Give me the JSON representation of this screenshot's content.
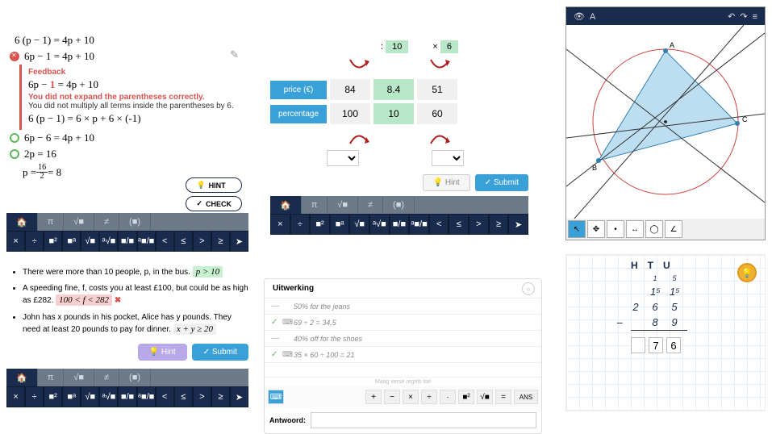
{
  "panel1": {
    "step1": "6 (p − 1) = 4p + 10",
    "step2": "6p − 1 = 4p + 10",
    "feedback": {
      "title": "Feedback",
      "eq_pre": "6p − ",
      "eq_red": "1",
      "eq_post": " = 4p + 10",
      "msg": "You did not expand the parentheses correctly.",
      "note": "You did not multiply all terms inside the parentheses by 6.",
      "expand": "6 (p − 1) = 6 × p + 6 × (-1)"
    },
    "step3": "6p − 6 = 4p + 10",
    "step4": "2p = 16",
    "step5_pre": "p = ",
    "step5_num": "16",
    "step5_den": "2",
    "step5_post": " = 8",
    "hint": "HINT",
    "check": "CHECK"
  },
  "panel2": {
    "op1_sym": ":",
    "op1_val": "10",
    "op2_sym": "×",
    "op2_val": "6",
    "row1_label": "price (€)",
    "row1": [
      "84",
      "8.4",
      "51"
    ],
    "row2_label": "percentage",
    "row2": [
      "100",
      "10",
      "60"
    ],
    "hint": "Hint",
    "submit": "Submit"
  },
  "panel3": {
    "labels": [
      "A",
      "B",
      "C"
    ]
  },
  "panel4": {
    "li1_text": "There were more than 10 people, p, in the bus.  ",
    "li1_chip": "p > 10",
    "li2_text": "A speeding fine, f, costs you at least £100, but could be as high as £282.  ",
    "li2_chip": "100 < f < 282",
    "li3_text": "John has x pounds in his pocket, Alice has y pounds. They need at least 20 pounds to pay for dinner.  ",
    "li3_chip": "x + y ≥ 20",
    "hint": "Hint",
    "submit": "Submit"
  },
  "panel5": {
    "title": "Uitwerking",
    "rows": [
      {
        "mark": "—",
        "kb": "",
        "txt": "50% for the jeans"
      },
      {
        "mark": "✓",
        "kb": "⌨",
        "txt": "69 ÷ 2 = 34,5"
      },
      {
        "mark": "—",
        "kb": "",
        "txt": "40% off for the shoes"
      },
      {
        "mark": "✓",
        "kb": "⌨",
        "txt": "35 × 60 ÷ 100 = 21"
      }
    ],
    "note": "Maag verse regels toe",
    "keys": [
      "+",
      "−",
      "×",
      "÷",
      "·",
      "■²",
      "√■",
      "=",
      "ANS"
    ],
    "answer_label": "Antwoord:"
  },
  "panel6": {
    "headers": [
      "H",
      "T",
      "U"
    ],
    "carry_row": [
      "",
      "1",
      "5"
    ],
    "row1": [
      "",
      "1⁵",
      "1⁵"
    ],
    "row2": [
      "2",
      "6",
      "5"
    ],
    "row3": [
      "",
      "8",
      "9"
    ],
    "ans": [
      "",
      "7",
      "6"
    ]
  },
  "toolbar": {
    "tabs": [
      "π",
      "√■",
      "≠",
      "(■)"
    ],
    "keys": [
      "×",
      "÷",
      "■²",
      "■ᵃ",
      "√■",
      "ᵃ√■",
      "■/■",
      "ᵃ■/■",
      "<",
      "≤",
      ">",
      "≥",
      "➤"
    ]
  }
}
